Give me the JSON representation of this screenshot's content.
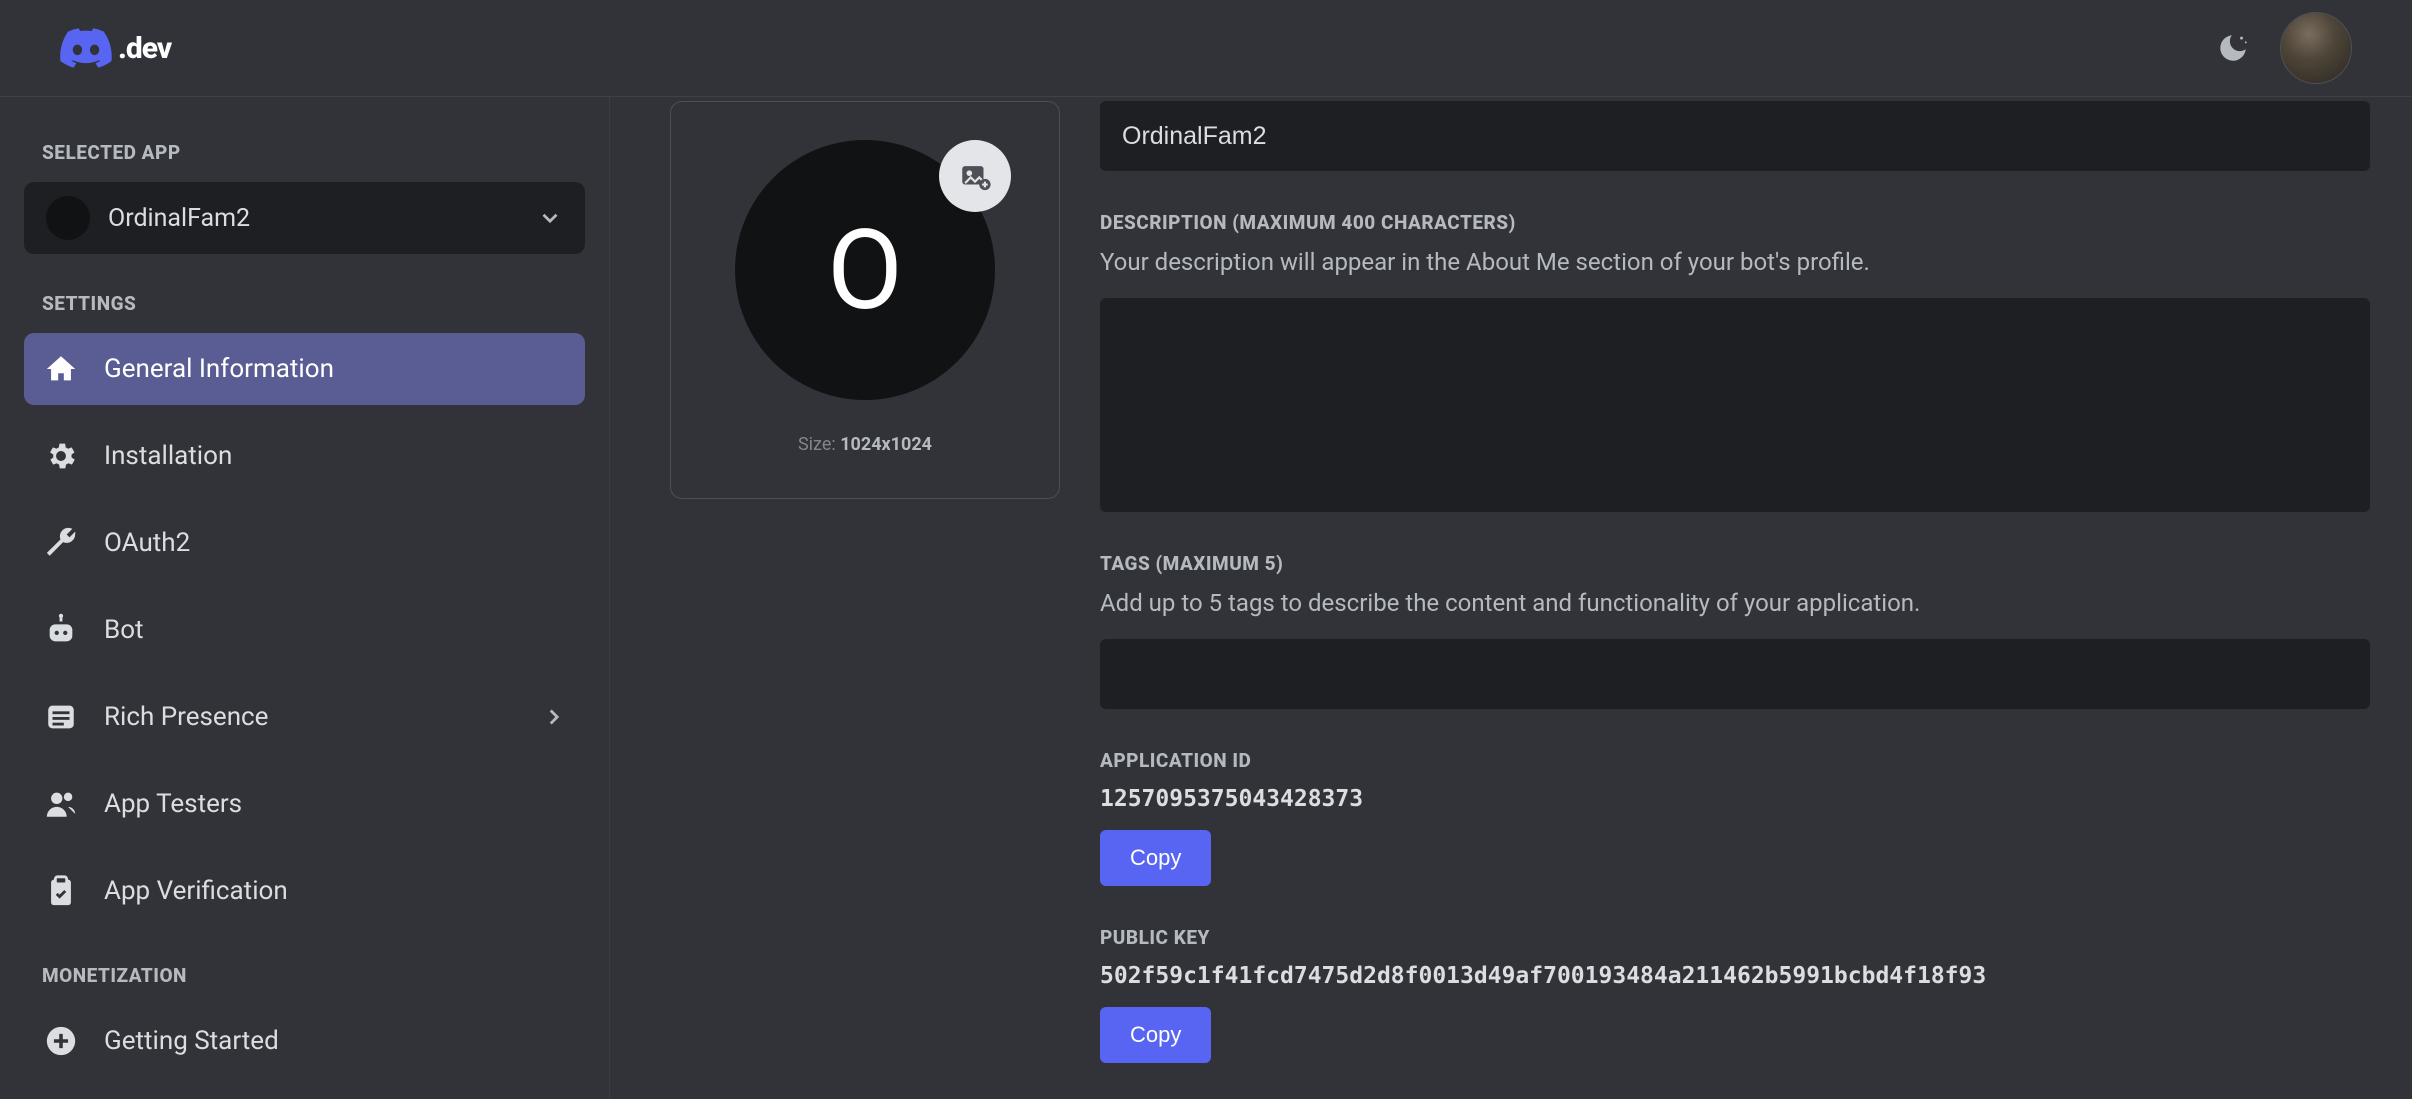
{
  "header": {
    "logo_text": ".dev"
  },
  "sidebar": {
    "selected_app_heading": "SELECTED APP",
    "selected_app_name": "OrdinalFam2",
    "settings_heading": "SETTINGS",
    "items": [
      {
        "label": "General Information"
      },
      {
        "label": "Installation"
      },
      {
        "label": "OAuth2"
      },
      {
        "label": "Bot"
      },
      {
        "label": "Rich Presence"
      },
      {
        "label": "App Testers"
      },
      {
        "label": "App Verification"
      }
    ],
    "monetization_heading": "MONETIZATION",
    "monetization_items": [
      {
        "label": "Getting Started"
      }
    ]
  },
  "avatar_card": {
    "initial": "O",
    "size_prefix": "Size: ",
    "size_value": "1024x1024"
  },
  "form": {
    "name_value": "OrdinalFam2",
    "description_label": "DESCRIPTION (MAXIMUM 400 CHARACTERS)",
    "description_sub": "Your description will appear in the About Me section of your bot's profile.",
    "description_value": "",
    "tags_label": "TAGS (MAXIMUM 5)",
    "tags_sub": "Add up to 5 tags to describe the content and functionality of your application.",
    "app_id_label": "APPLICATION ID",
    "app_id_value": "1257095375043428373",
    "app_id_copy": "Copy",
    "public_key_label": "PUBLIC KEY",
    "public_key_value": "502f59c1f41fcd7475d2d8f0013d49af700193484a211462b5991bcbd4f18f93",
    "public_key_copy": "Copy"
  }
}
